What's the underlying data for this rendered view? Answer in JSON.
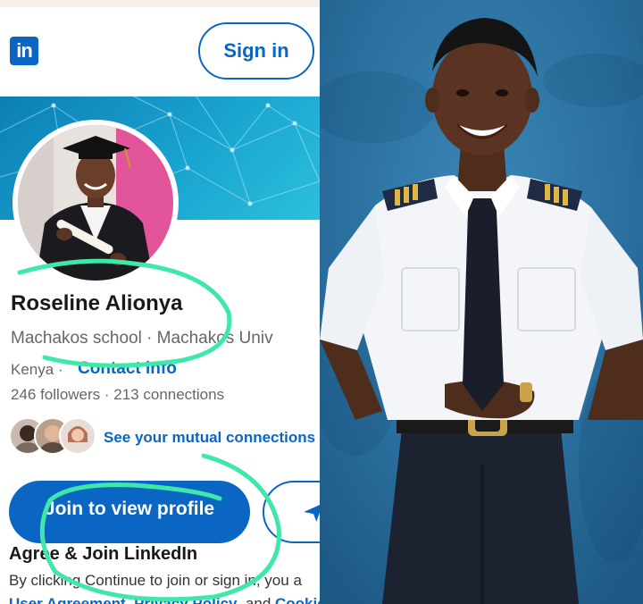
{
  "linkedin": {
    "logo_text": "in",
    "signin_label": "Sign in",
    "profile": {
      "name": "Roseline Alionya",
      "schools": "Machakos school  ·  Machakos Univ",
      "location": "Kenya  ·",
      "contact_label": "Contact info",
      "stats": "246 followers  ·  213 connections"
    },
    "mutual_label": "See your mutual connections",
    "join_label": "Join to view profile",
    "agree_title": "Agree & Join LinkedIn",
    "agree_text": "By clicking Continue to join or sign in, you a",
    "agree_links": {
      "user_agreement": "User Agreement",
      "privacy": "Privacy Policy",
      "and": ", and",
      "cookie": "Cookie"
    }
  },
  "colors": {
    "brand": "#0a66c2",
    "scribble": "#3fe8a8"
  },
  "icons": [
    "linkedin-logo",
    "send-icon"
  ]
}
